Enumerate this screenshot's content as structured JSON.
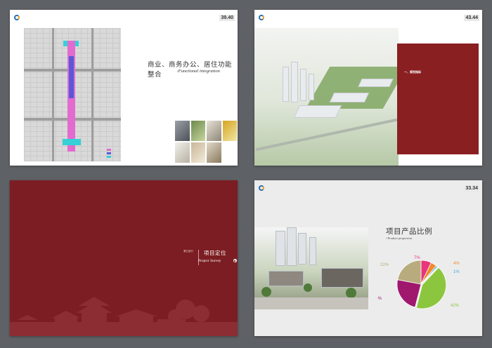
{
  "spread1": {
    "page_number": "39.40",
    "section_title": "商业、商务办公、居住功能整合",
    "section_title_en": "/Functional integration",
    "legend": [
      "",
      "",
      ""
    ],
    "colors": {
      "axis": "#e36bd0",
      "core": "#5a58d8",
      "node": "#36d1d6"
    }
  },
  "spread2": {
    "page_number": "43.44",
    "panel_heading": "一、规划指标"
  },
  "spread3": {
    "section_label": "第五部分",
    "title": "项目定位",
    "title_en": "Project Survey",
    "background": "#7b1d22"
  },
  "spread4": {
    "page_number": "33.34",
    "title": "项目产品比例",
    "title_en": "/ Product proportion",
    "chart_data": {
      "type": "pie",
      "title": "",
      "values": [
        7,
        4,
        1,
        42,
        24,
        22
      ],
      "labels": [
        "7%",
        "4%",
        "1%",
        "42%",
        "24%",
        "22%"
      ],
      "colors": [
        "#e8357c",
        "#f08a2a",
        "#39a9e0",
        "#8cc63f",
        "#a0176e",
        "#b8ac7e"
      ],
      "legend": "none"
    }
  }
}
